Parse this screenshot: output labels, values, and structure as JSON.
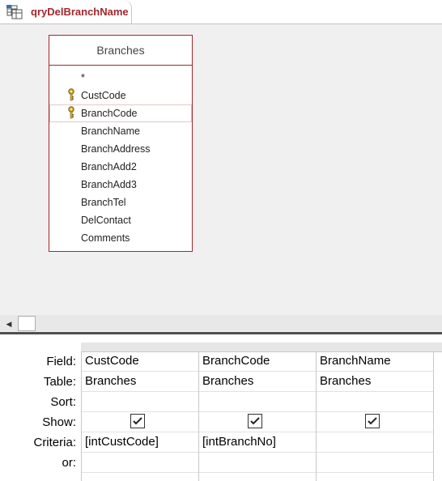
{
  "tab": {
    "title": "qryDelBranchName"
  },
  "table": {
    "name": "Branches",
    "fields": [
      {
        "name": "*",
        "key": false
      },
      {
        "name": "CustCode",
        "key": true
      },
      {
        "name": "BranchCode",
        "key": true
      },
      {
        "name": "BranchName",
        "key": false
      },
      {
        "name": "BranchAddress",
        "key": false
      },
      {
        "name": "BranchAdd2",
        "key": false
      },
      {
        "name": "BranchAdd3",
        "key": false
      },
      {
        "name": "BranchTel",
        "key": false
      },
      {
        "name": "DelContact",
        "key": false
      },
      {
        "name": "Comments",
        "key": false
      }
    ]
  },
  "grid": {
    "row_labels": [
      "Field:",
      "Table:",
      "Sort:",
      "Show:",
      "Criteria:",
      "or:"
    ],
    "columns": [
      {
        "field": "CustCode",
        "table": "Branches",
        "sort": "",
        "show": true,
        "criteria": "[intCustCode]",
        "or": ""
      },
      {
        "field": "BranchCode",
        "table": "Branches",
        "sort": "",
        "show": true,
        "criteria": "[intBranchNo]",
        "or": ""
      },
      {
        "field": "BranchName",
        "table": "Branches",
        "sort": "",
        "show": true,
        "criteria": "",
        "or": ""
      }
    ]
  },
  "colors": {
    "accent": "#a4262c",
    "grid_line": "#c8c8c8",
    "splitter": "#505050"
  }
}
